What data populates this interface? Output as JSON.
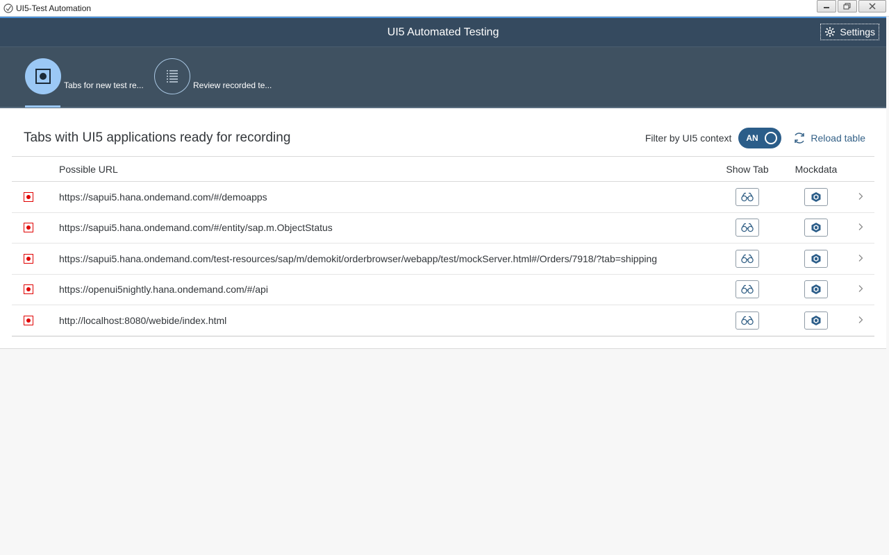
{
  "window": {
    "title": "UI5-Test Automation"
  },
  "shell": {
    "title": "UI5 Automated Testing",
    "settings_label": "Settings"
  },
  "tabs": [
    {
      "label": "Tabs for new test re...",
      "icon": "record-icon",
      "selected": true
    },
    {
      "label": "Review recorded te...",
      "icon": "list-icon",
      "selected": false
    }
  ],
  "panel": {
    "title": "Tabs with UI5 applications ready for recording",
    "filter_label": "Filter by UI5 context",
    "switch_text": "AN",
    "reload_label": "Reload table"
  },
  "table": {
    "columns": [
      "",
      "Possible URL",
      "Show Tab",
      "Mockdata",
      ""
    ],
    "rows": [
      {
        "url": "https://sapui5.hana.ondemand.com/#/demoapps"
      },
      {
        "url": "https://sapui5.hana.ondemand.com/#/entity/sap.m.ObjectStatus"
      },
      {
        "url": "https://sapui5.hana.ondemand.com/test-resources/sap/m/demokit/orderbrowser/webapp/test/mockServer.html#/Orders/7918/?tab=shipping"
      },
      {
        "url": "https://openui5nightly.hana.ondemand.com/#/api"
      },
      {
        "url": "http://localhost:8080/webide/index.html"
      }
    ]
  },
  "colors": {
    "shell_bg": "#354a5f",
    "tabbar_bg": "#3f5161",
    "tab_active": "#9bc8f5",
    "accent_blue": "#346187",
    "status_red": "#e00000"
  }
}
